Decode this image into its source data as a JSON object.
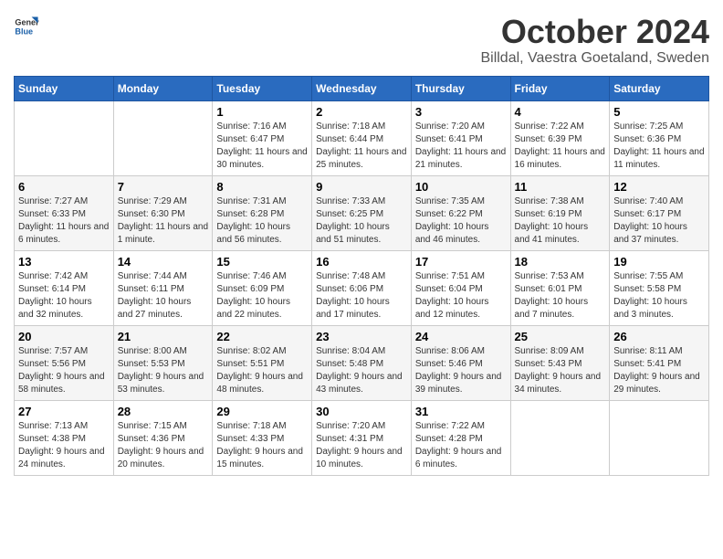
{
  "logo": {
    "line1": "General",
    "line2": "Blue"
  },
  "title": "October 2024",
  "location": "Billdal, Vaestra Goetaland, Sweden",
  "headers": [
    "Sunday",
    "Monday",
    "Tuesday",
    "Wednesday",
    "Thursday",
    "Friday",
    "Saturday"
  ],
  "weeks": [
    [
      {
        "day": "",
        "info": ""
      },
      {
        "day": "",
        "info": ""
      },
      {
        "day": "1",
        "info": "Sunrise: 7:16 AM\nSunset: 6:47 PM\nDaylight: 11 hours and 30 minutes."
      },
      {
        "day": "2",
        "info": "Sunrise: 7:18 AM\nSunset: 6:44 PM\nDaylight: 11 hours and 25 minutes."
      },
      {
        "day": "3",
        "info": "Sunrise: 7:20 AM\nSunset: 6:41 PM\nDaylight: 11 hours and 21 minutes."
      },
      {
        "day": "4",
        "info": "Sunrise: 7:22 AM\nSunset: 6:39 PM\nDaylight: 11 hours and 16 minutes."
      },
      {
        "day": "5",
        "info": "Sunrise: 7:25 AM\nSunset: 6:36 PM\nDaylight: 11 hours and 11 minutes."
      }
    ],
    [
      {
        "day": "6",
        "info": "Sunrise: 7:27 AM\nSunset: 6:33 PM\nDaylight: 11 hours and 6 minutes."
      },
      {
        "day": "7",
        "info": "Sunrise: 7:29 AM\nSunset: 6:30 PM\nDaylight: 11 hours and 1 minute."
      },
      {
        "day": "8",
        "info": "Sunrise: 7:31 AM\nSunset: 6:28 PM\nDaylight: 10 hours and 56 minutes."
      },
      {
        "day": "9",
        "info": "Sunrise: 7:33 AM\nSunset: 6:25 PM\nDaylight: 10 hours and 51 minutes."
      },
      {
        "day": "10",
        "info": "Sunrise: 7:35 AM\nSunset: 6:22 PM\nDaylight: 10 hours and 46 minutes."
      },
      {
        "day": "11",
        "info": "Sunrise: 7:38 AM\nSunset: 6:19 PM\nDaylight: 10 hours and 41 minutes."
      },
      {
        "day": "12",
        "info": "Sunrise: 7:40 AM\nSunset: 6:17 PM\nDaylight: 10 hours and 37 minutes."
      }
    ],
    [
      {
        "day": "13",
        "info": "Sunrise: 7:42 AM\nSunset: 6:14 PM\nDaylight: 10 hours and 32 minutes."
      },
      {
        "day": "14",
        "info": "Sunrise: 7:44 AM\nSunset: 6:11 PM\nDaylight: 10 hours and 27 minutes."
      },
      {
        "day": "15",
        "info": "Sunrise: 7:46 AM\nSunset: 6:09 PM\nDaylight: 10 hours and 22 minutes."
      },
      {
        "day": "16",
        "info": "Sunrise: 7:48 AM\nSunset: 6:06 PM\nDaylight: 10 hours and 17 minutes."
      },
      {
        "day": "17",
        "info": "Sunrise: 7:51 AM\nSunset: 6:04 PM\nDaylight: 10 hours and 12 minutes."
      },
      {
        "day": "18",
        "info": "Sunrise: 7:53 AM\nSunset: 6:01 PM\nDaylight: 10 hours and 7 minutes."
      },
      {
        "day": "19",
        "info": "Sunrise: 7:55 AM\nSunset: 5:58 PM\nDaylight: 10 hours and 3 minutes."
      }
    ],
    [
      {
        "day": "20",
        "info": "Sunrise: 7:57 AM\nSunset: 5:56 PM\nDaylight: 9 hours and 58 minutes."
      },
      {
        "day": "21",
        "info": "Sunrise: 8:00 AM\nSunset: 5:53 PM\nDaylight: 9 hours and 53 minutes."
      },
      {
        "day": "22",
        "info": "Sunrise: 8:02 AM\nSunset: 5:51 PM\nDaylight: 9 hours and 48 minutes."
      },
      {
        "day": "23",
        "info": "Sunrise: 8:04 AM\nSunset: 5:48 PM\nDaylight: 9 hours and 43 minutes."
      },
      {
        "day": "24",
        "info": "Sunrise: 8:06 AM\nSunset: 5:46 PM\nDaylight: 9 hours and 39 minutes."
      },
      {
        "day": "25",
        "info": "Sunrise: 8:09 AM\nSunset: 5:43 PM\nDaylight: 9 hours and 34 minutes."
      },
      {
        "day": "26",
        "info": "Sunrise: 8:11 AM\nSunset: 5:41 PM\nDaylight: 9 hours and 29 minutes."
      }
    ],
    [
      {
        "day": "27",
        "info": "Sunrise: 7:13 AM\nSunset: 4:38 PM\nDaylight: 9 hours and 24 minutes."
      },
      {
        "day": "28",
        "info": "Sunrise: 7:15 AM\nSunset: 4:36 PM\nDaylight: 9 hours and 20 minutes."
      },
      {
        "day": "29",
        "info": "Sunrise: 7:18 AM\nSunset: 4:33 PM\nDaylight: 9 hours and 15 minutes."
      },
      {
        "day": "30",
        "info": "Sunrise: 7:20 AM\nSunset: 4:31 PM\nDaylight: 9 hours and 10 minutes."
      },
      {
        "day": "31",
        "info": "Sunrise: 7:22 AM\nSunset: 4:28 PM\nDaylight: 9 hours and 6 minutes."
      },
      {
        "day": "",
        "info": ""
      },
      {
        "day": "",
        "info": ""
      }
    ]
  ]
}
